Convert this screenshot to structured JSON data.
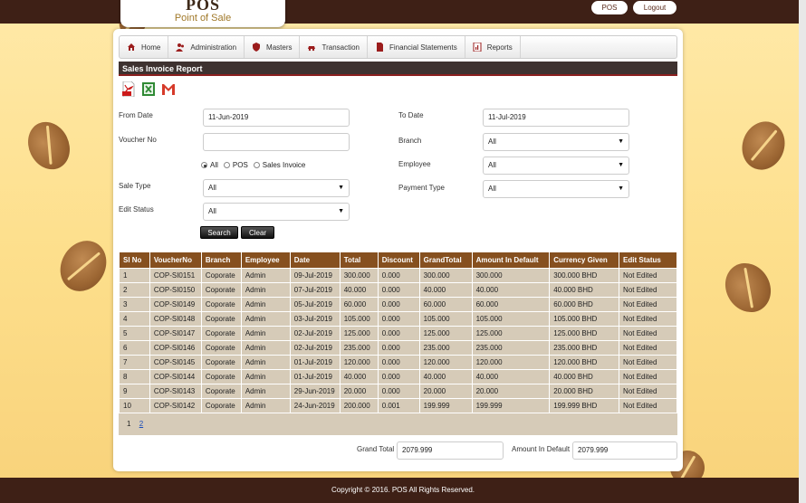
{
  "header": {
    "logo_text": "POS",
    "logo_subtitle": "Point of Sale",
    "pos_button": "POS",
    "logout_button": "Logout"
  },
  "nav": {
    "items": [
      {
        "label": "Home",
        "icon": "home-icon"
      },
      {
        "label": "Administration",
        "icon": "users-icon"
      },
      {
        "label": "Masters",
        "icon": "shield-icon"
      },
      {
        "label": "Transaction",
        "icon": "car-icon"
      },
      {
        "label": "Financial Statements",
        "icon": "document-icon"
      },
      {
        "label": "Reports",
        "icon": "report-icon"
      }
    ]
  },
  "page": {
    "title": "Sales Invoice Report"
  },
  "filters": {
    "from_date_label": "From Date",
    "from_date_value": "11-Jun-2019",
    "to_date_label": "To Date",
    "to_date_value": "11-Jul-2019",
    "voucher_no_label": "Voucher No",
    "voucher_no_value": "",
    "branch_label": "Branch",
    "branch_value": "All",
    "employee_label": "Employee",
    "employee_value": "All",
    "radio_all": "All",
    "radio_pos": "POS",
    "radio_sales_invoice": "Sales Invoice",
    "radio_selected": "All",
    "sale_type_label": "Sale Type",
    "sale_type_value": "All",
    "payment_type_label": "Payment Type",
    "payment_type_value": "All",
    "edit_status_label": "Edit Status",
    "edit_status_value": "All",
    "search_button": "Search",
    "clear_button": "Clear"
  },
  "table": {
    "columns": [
      "Sl No",
      "VoucherNo",
      "Branch",
      "Employee",
      "Date",
      "Total",
      "Discount",
      "GrandTotal",
      "Amount In Default",
      "Currency Given",
      "Edit Status"
    ],
    "rows": [
      [
        "1",
        "COP-SI0151",
        "Coporate",
        "Admin",
        "09-Jul-2019",
        "300.000",
        "0.000",
        "300.000",
        "300.000",
        "300.000 BHD",
        "Not Edited"
      ],
      [
        "2",
        "COP-SI0150",
        "Coporate",
        "Admin",
        "07-Jul-2019",
        "40.000",
        "0.000",
        "40.000",
        "40.000",
        "40.000 BHD",
        "Not Edited"
      ],
      [
        "3",
        "COP-SI0149",
        "Coporate",
        "Admin",
        "05-Jul-2019",
        "60.000",
        "0.000",
        "60.000",
        "60.000",
        "60.000 BHD",
        "Not Edited"
      ],
      [
        "4",
        "COP-SI0148",
        "Coporate",
        "Admin",
        "03-Jul-2019",
        "105.000",
        "0.000",
        "105.000",
        "105.000",
        "105.000 BHD",
        "Not Edited"
      ],
      [
        "5",
        "COP-SI0147",
        "Coporate",
        "Admin",
        "02-Jul-2019",
        "125.000",
        "0.000",
        "125.000",
        "125.000",
        "125.000 BHD",
        "Not Edited"
      ],
      [
        "6",
        "COP-SI0146",
        "Coporate",
        "Admin",
        "02-Jul-2019",
        "235.000",
        "0.000",
        "235.000",
        "235.000",
        "235.000 BHD",
        "Not Edited"
      ],
      [
        "7",
        "COP-SI0145",
        "Coporate",
        "Admin",
        "01-Jul-2019",
        "120.000",
        "0.000",
        "120.000",
        "120.000",
        "120.000 BHD",
        "Not Edited"
      ],
      [
        "8",
        "COP-SI0144",
        "Coporate",
        "Admin",
        "01-Jul-2019",
        "40.000",
        "0.000",
        "40.000",
        "40.000",
        "40.000 BHD",
        "Not Edited"
      ],
      [
        "9",
        "COP-SI0143",
        "Coporate",
        "Admin",
        "29-Jun-2019",
        "20.000",
        "0.000",
        "20.000",
        "20.000",
        "20.000 BHD",
        "Not Edited"
      ],
      [
        "10",
        "COP-SI0142",
        "Coporate",
        "Admin",
        "24-Jun-2019",
        "200.000",
        "0.001",
        "199.999",
        "199.999",
        "199.999 BHD",
        "Not Edited"
      ]
    ]
  },
  "pagination": {
    "pages": [
      "1",
      "2"
    ],
    "current": "1"
  },
  "totals": {
    "grand_total_label": "Grand Total",
    "grand_total_value": "2079.999",
    "amount_default_label": "Amount In Default",
    "amount_default_value": "2079.999"
  },
  "footer": {
    "copyright": "Copyright © 2016. POS All Rights Reserved."
  },
  "colors": {
    "brand_dark": "#3e2016",
    "table_header": "#86501f",
    "table_row": "#d6cbb8"
  }
}
